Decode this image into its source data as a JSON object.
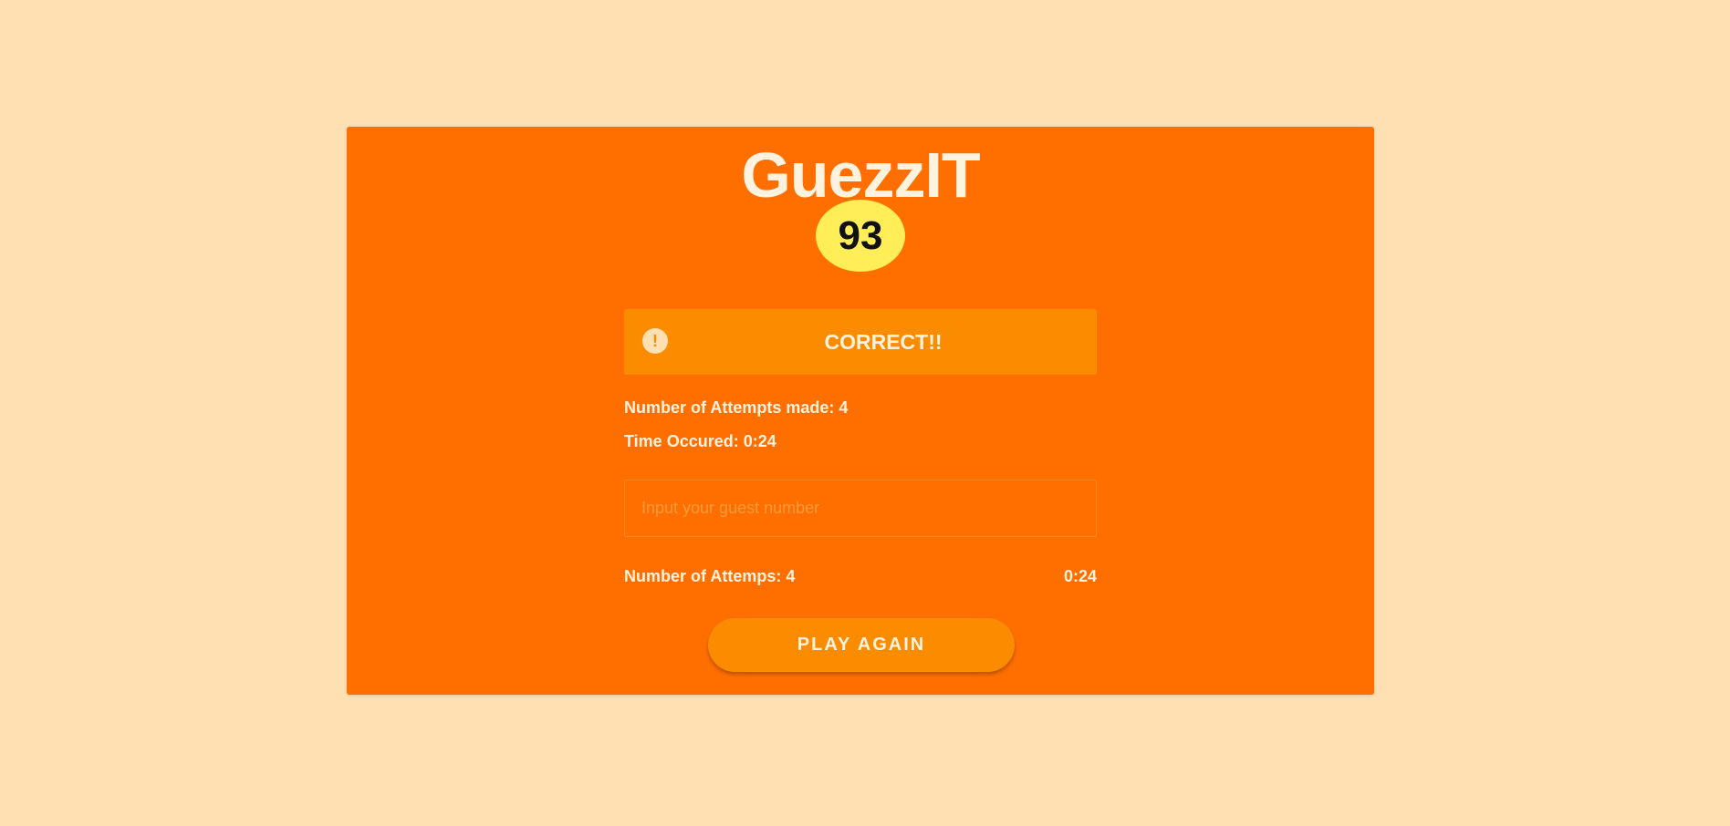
{
  "app": {
    "title": "GuezzIT",
    "secret_number": "93"
  },
  "alert": {
    "icon": "exclamation-icon",
    "icon_glyph": "!",
    "message": "CORRECT!!"
  },
  "stats": {
    "attempts_label": "Number of Attempts made: 4",
    "time_label": "Time Occured: 0:24"
  },
  "guess": {
    "value": "",
    "placeholder": "Input your guest number"
  },
  "footer": {
    "attempts_label": "Number of Attemps: 4",
    "timer": "0:24"
  },
  "actions": {
    "play_again_label": "PLAY AGAIN"
  },
  "colors": {
    "page_background": "#ffe0b2",
    "card_background": "#ff6f00",
    "alert_background": "#fb8c00",
    "badge_background": "#ffee58",
    "text_light": "#fff3e0"
  }
}
